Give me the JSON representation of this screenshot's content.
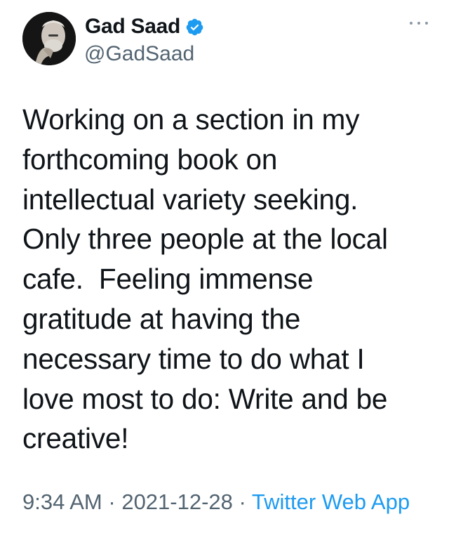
{
  "author": {
    "name": "Gad Saad",
    "handle": "@GadSaad",
    "verified": true,
    "avatar_icon": "profile-photo"
  },
  "tweet": {
    "lines": [
      "Working on a section in my",
      "forthcoming book on",
      "intellectual variety seeking.",
      "Only three people at the local",
      "cafe.  Feeling immense",
      "gratitude at having the",
      "necessary time to do what I",
      "love most to do: Write and be",
      "creative!"
    ],
    "time": "9:34 AM",
    "separator": "·",
    "date": "2021-12-28",
    "source": "Twitter Web App"
  },
  "icons": {
    "more": "more-options-icon",
    "verified": "verified-badge-icon"
  },
  "colors": {
    "text": "#0f1419",
    "secondary": "#536471",
    "accent": "#1d9bf0"
  }
}
